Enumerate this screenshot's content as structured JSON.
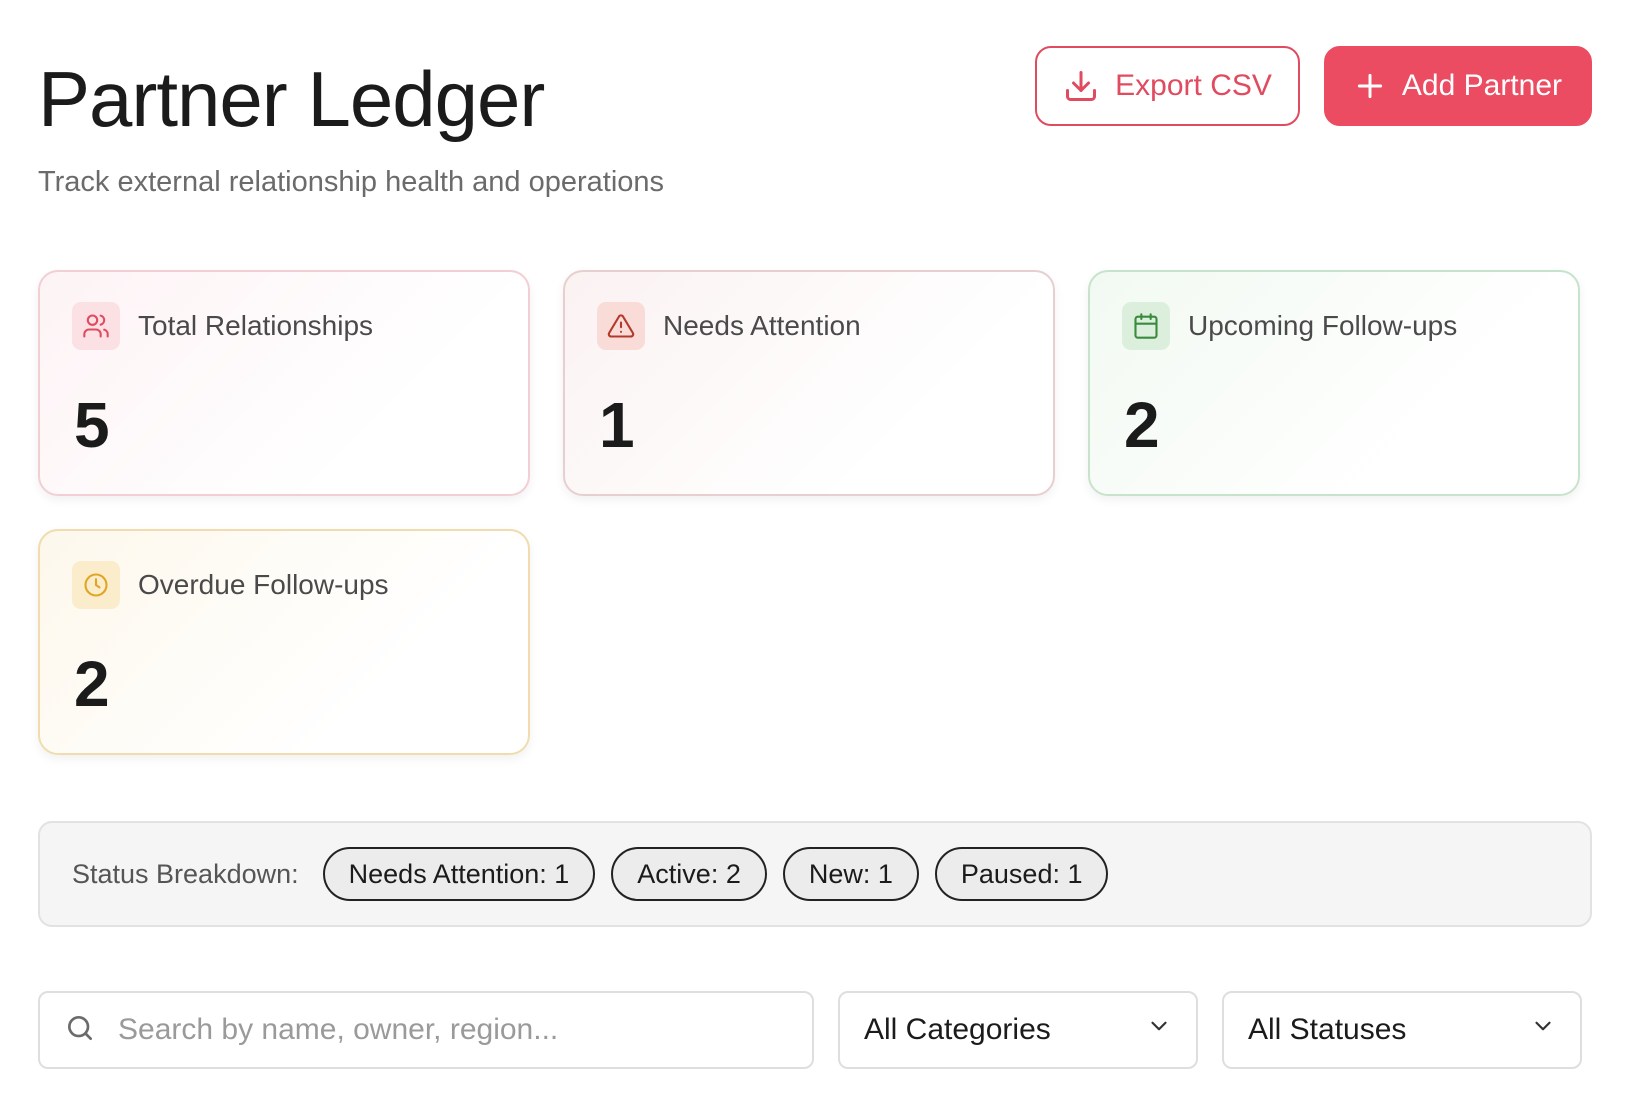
{
  "header": {
    "title": "Partner Ledger",
    "subtitle": "Track external relationship health and operations",
    "export_label": "Export CSV",
    "add_label": "Add Partner"
  },
  "stats": [
    {
      "label": "Total Relationships",
      "value": "5",
      "icon": "users-icon",
      "tone": "pink"
    },
    {
      "label": "Needs Attention",
      "value": "1",
      "icon": "alert-triangle-icon",
      "tone": "red"
    },
    {
      "label": "Upcoming Follow-ups",
      "value": "2",
      "icon": "calendar-icon",
      "tone": "green"
    },
    {
      "label": "Overdue Follow-ups",
      "value": "2",
      "icon": "clock-icon",
      "tone": "yellow"
    }
  ],
  "status_breakdown": {
    "label": "Status Breakdown:",
    "chips": [
      {
        "label": "Needs Attention: 1"
      },
      {
        "label": "Active: 2"
      },
      {
        "label": "New: 1"
      },
      {
        "label": "Paused: 1"
      }
    ]
  },
  "filters": {
    "search_placeholder": "Search by name, owner, region...",
    "category_selected": "All Categories",
    "status_selected": "All Statuses"
  },
  "colors": {
    "accent": "#ec4c61",
    "pink": "#e04b5f",
    "red": "#b23a2c",
    "green": "#3a8a3e",
    "yellow": "#e0a623"
  }
}
